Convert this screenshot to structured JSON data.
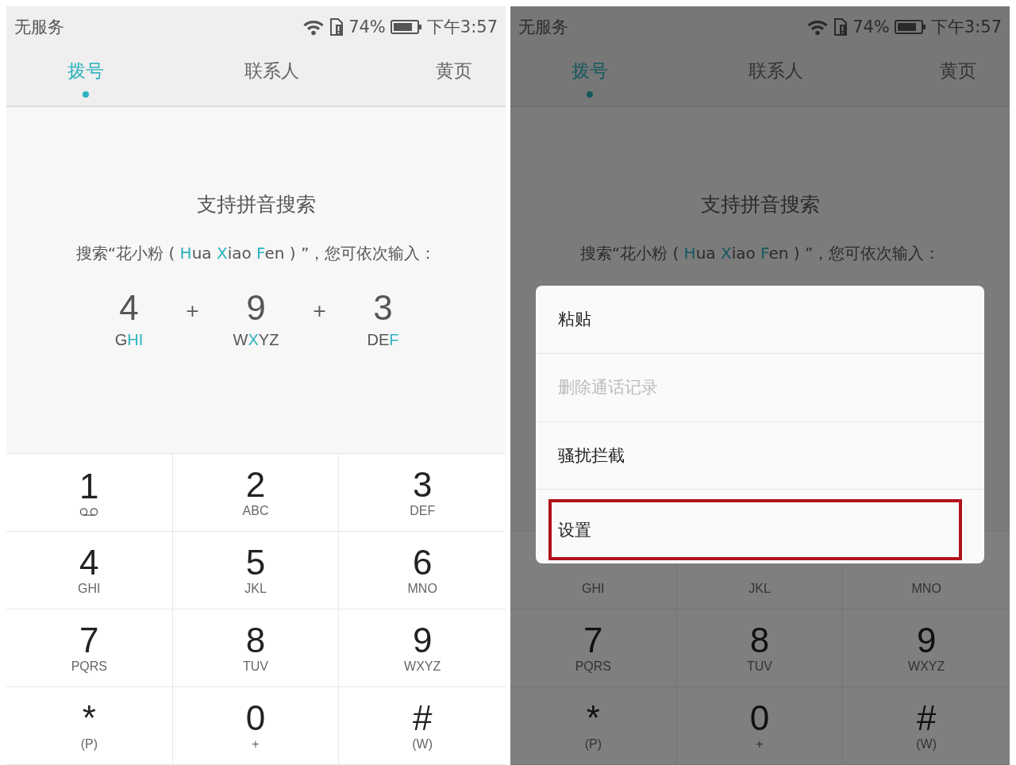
{
  "screens": [
    {
      "status_bar": {
        "carrier": "无服务",
        "battery": "74%",
        "time": "下午3:57"
      },
      "tabs": [
        {
          "label": "拨号",
          "selected": true
        },
        {
          "label": "联系人",
          "selected": false
        },
        {
          "label": "黄页",
          "selected": false
        }
      ],
      "title": "支持拼音搜索",
      "hint": [
        {
          "text": "搜索“花小粉 ( ",
          "highlight": false
        },
        {
          "text": "H",
          "highlight": true
        },
        {
          "text": "ua ",
          "highlight": false
        },
        {
          "text": "X",
          "highlight": true
        },
        {
          "text": "iao ",
          "highlight": false
        },
        {
          "text": "F",
          "highlight": true
        },
        {
          "text": "en ) ”，您可依次输入：",
          "highlight": false
        }
      ],
      "example": {
        "keys": [
          {
            "digit": "4",
            "letters": [
              {
                "text": "G",
                "highlight": false
              },
              {
                "text": "HI",
                "highlight": true
              }
            ]
          },
          {
            "digit": "9",
            "letters": [
              {
                "text": "W",
                "highlight": false
              },
              {
                "text": "X",
                "highlight": true
              },
              {
                "text": "YZ",
                "highlight": false
              }
            ]
          },
          {
            "digit": "3",
            "letters": [
              {
                "text": "DE",
                "highlight": false
              },
              {
                "text": "F",
                "highlight": true
              }
            ]
          }
        ],
        "joiner": "+"
      },
      "dimmed": false,
      "keys": [
        {
          "digit": "1",
          "kind": "voicemail"
        },
        {
          "digit": "2",
          "kind": "letters",
          "letters": "ABC"
        },
        {
          "digit": "3",
          "kind": "letters",
          "letters": "DEF"
        },
        {
          "digit": "4",
          "kind": "letters",
          "letters": "GHI"
        },
        {
          "digit": "5",
          "kind": "letters",
          "letters": "JKL"
        },
        {
          "digit": "6",
          "kind": "letters",
          "letters": "MNO"
        },
        {
          "digit": "7",
          "kind": "letters",
          "letters": "PQRS"
        },
        {
          "digit": "8",
          "kind": "letters",
          "letters": "TUV"
        },
        {
          "digit": "9",
          "kind": "letters",
          "letters": "WXYZ"
        },
        {
          "digit": "*",
          "kind": "letters",
          "letters": "(P)"
        },
        {
          "digit": "0",
          "kind": "letters",
          "letters": "+"
        },
        {
          "digit": "#",
          "kind": "letters",
          "letters": "(W)"
        }
      ]
    },
    {
      "status_bar": {
        "carrier": "无服务",
        "battery": "74%",
        "time": "下午3:57"
      },
      "tabs": [
        {
          "label": "拨号",
          "selected": true
        },
        {
          "label": "联系人",
          "selected": false
        },
        {
          "label": "黄页",
          "selected": false
        }
      ],
      "title": "支持拼音搜索",
      "hint": [
        {
          "text": "搜索“花小粉 ( ",
          "highlight": false
        },
        {
          "text": "H",
          "highlight": true
        },
        {
          "text": "ua ",
          "highlight": false
        },
        {
          "text": "X",
          "highlight": true
        },
        {
          "text": "iao ",
          "highlight": false
        },
        {
          "text": "F",
          "highlight": true
        },
        {
          "text": "en ) ”，您可依次输入：",
          "highlight": false
        }
      ],
      "dimmed": true,
      "menu": [
        {
          "label": "粘贴",
          "disabled": false,
          "highlighted": false
        },
        {
          "label": "删除通话记录",
          "disabled": true,
          "highlighted": false
        },
        {
          "label": "骚扰拦截",
          "disabled": false,
          "highlighted": false
        },
        {
          "label": "设置",
          "disabled": false,
          "highlighted": true
        }
      ],
      "keys": [
        {
          "kind": "letters",
          "letters": "GHI"
        },
        {
          "kind": "letters",
          "letters": "JKL"
        },
        {
          "kind": "letters",
          "letters": "MNO"
        },
        {
          "digit": "7",
          "kind": "letters",
          "letters": "PQRS"
        },
        {
          "digit": "8",
          "kind": "letters",
          "letters": "TUV"
        },
        {
          "digit": "9",
          "kind": "letters",
          "letters": "WXYZ"
        },
        {
          "digit": "*",
          "kind": "letters",
          "letters": "(P)"
        },
        {
          "digit": "0",
          "kind": "letters",
          "letters": "+"
        },
        {
          "digit": "#",
          "kind": "letters",
          "letters": "(W)"
        }
      ]
    }
  ]
}
